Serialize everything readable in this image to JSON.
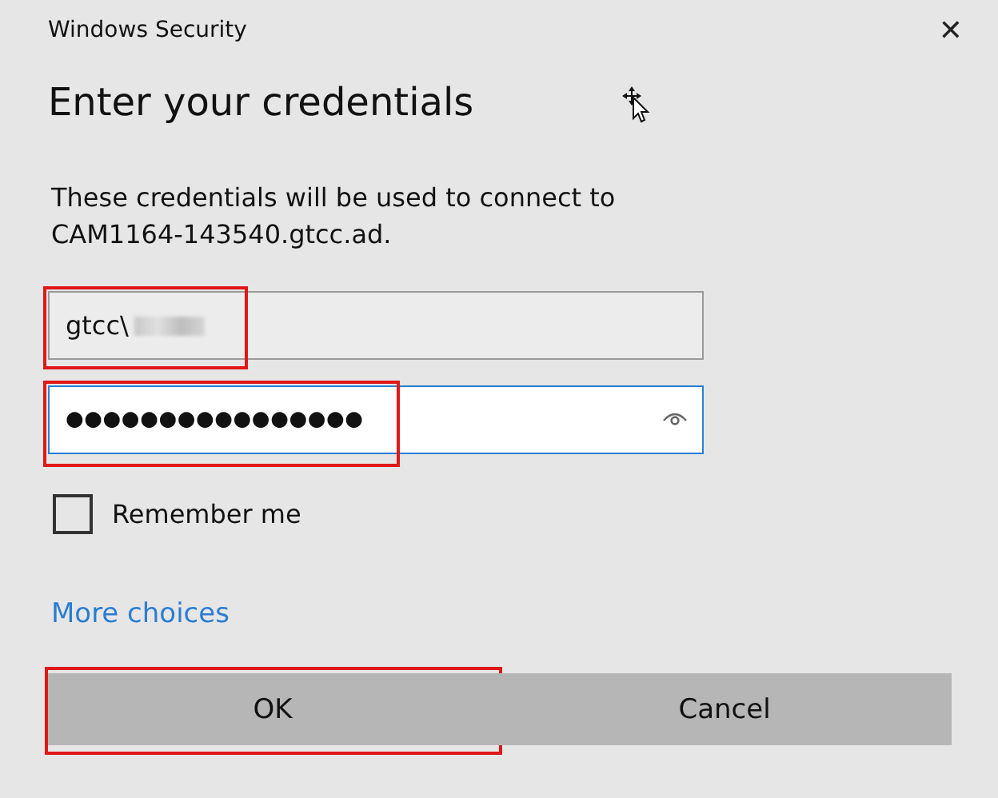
{
  "window": {
    "title": "Windows Security",
    "close": "✕"
  },
  "heading": "Enter your credentials",
  "message": "These credentials will be used to connect to CAM1164-143540.gtcc.ad.",
  "fields": [
    {
      "kind": "username",
      "value": "gtcc\\",
      "redacted": true,
      "focused": false,
      "annotated": true
    },
    {
      "kind": "password",
      "value": "●●●●●●●●●●●●●●●●",
      "redacted": false,
      "focused": true,
      "annotated": true
    }
  ],
  "remember": {
    "label": "Remember me",
    "checked": false
  },
  "more_choices": "More choices",
  "buttons": [
    {
      "label": "OK",
      "annotated": true
    },
    {
      "label": "Cancel",
      "annotated": false
    }
  ]
}
